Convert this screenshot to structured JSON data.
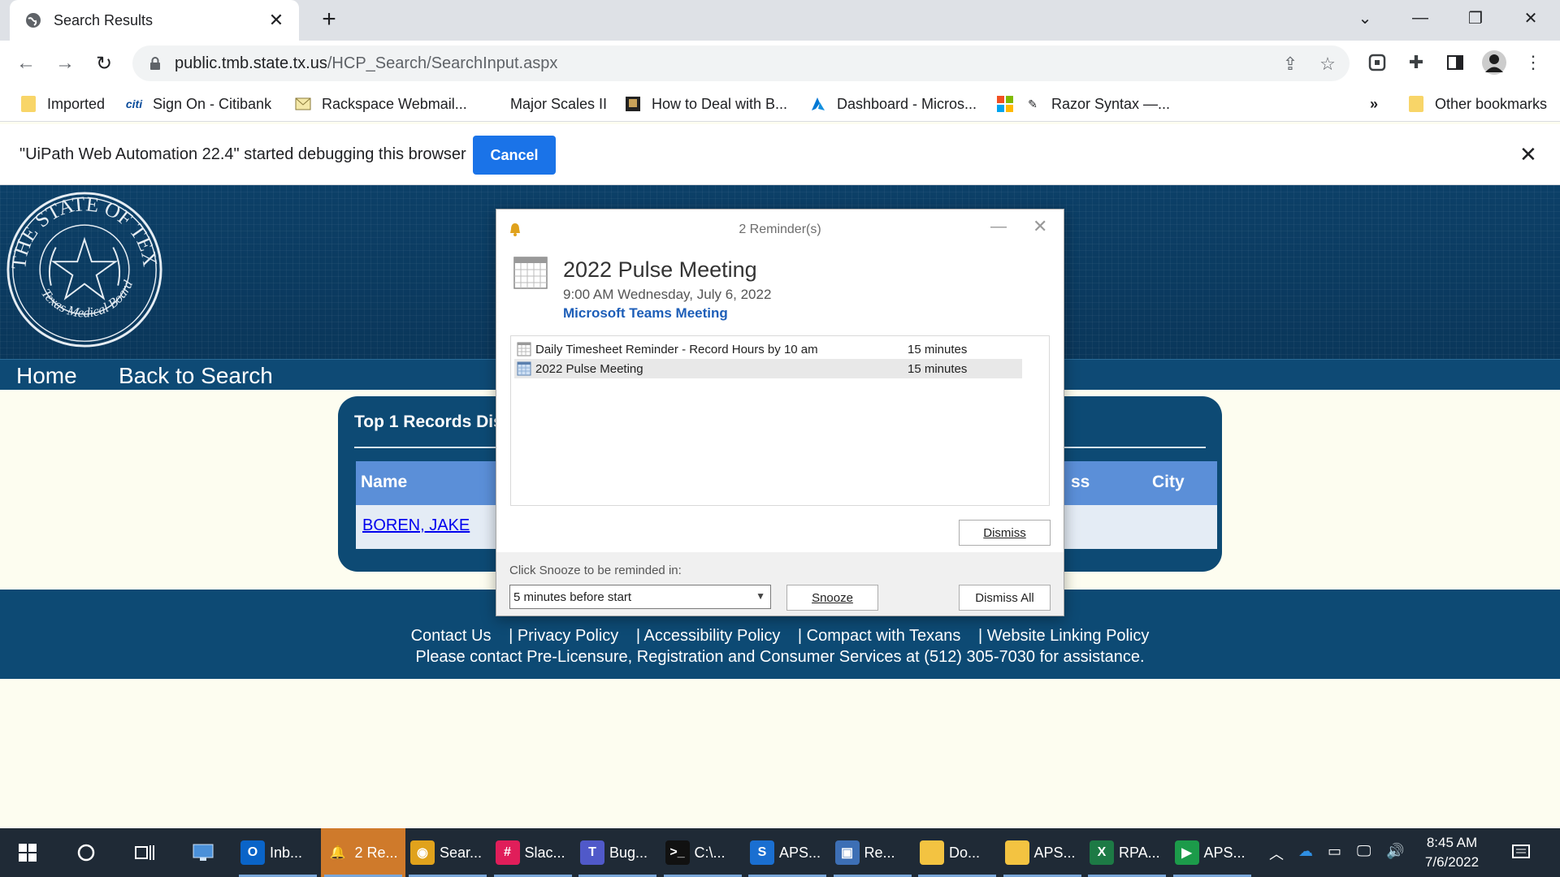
{
  "browser": {
    "tab": {
      "title": "Search Results"
    },
    "url_domain": "public.tmb.state.tx.us",
    "url_path": "/HCP_Search/SearchInput.aspx",
    "bookmarks": [
      {
        "label": "Imported"
      },
      {
        "label": "Sign On - Citibank",
        "icon_text": "citi"
      },
      {
        "label": "Rackspace Webmail..."
      },
      {
        "label": "Major Scales II"
      },
      {
        "label": "How to Deal with B..."
      },
      {
        "label": "Dashboard - Micros..."
      },
      {
        "label": "Razor Syntax —..."
      }
    ],
    "bookmarks_overflow": "»",
    "other_bookmarks": "Other bookmarks",
    "infobar": {
      "message": "\"UiPath Web Automation 22.4\" started debugging this browser",
      "cancel_label": "Cancel"
    }
  },
  "page": {
    "seal_text": "THE STATE OF TEXAS",
    "seal_subtext": "Texas Medical Board",
    "nav": {
      "home": "Home",
      "back": "Back to Search"
    },
    "results": {
      "title": "Top 1 Records Dis",
      "columns": [
        "Name",
        "ss",
        "City"
      ],
      "rows": [
        {
          "name": "BOREN, JAKE"
        }
      ]
    },
    "footer": {
      "links": [
        "Contact Us",
        "| Privacy Policy",
        "| Accessibility Policy",
        "| Compact with Texans",
        "| Website Linking Policy"
      ],
      "contact": "Please contact Pre-Licensure, Registration and Consumer Services at (512) 305-7030 for assistance."
    }
  },
  "reminder": {
    "window_title": "2 Reminder(s)",
    "subject": "2022 Pulse Meeting",
    "when": "9:00 AM Wednesday, July 6, 2022",
    "location": "Microsoft Teams Meeting",
    "items": [
      {
        "label": "Daily Timesheet Reminder - Record Hours by 10 am",
        "due": "15 minutes",
        "selected": false
      },
      {
        "label": "2022 Pulse Meeting",
        "due": "15 minutes",
        "selected": true
      }
    ],
    "dismiss_label": "Dismiss",
    "snooze_prompt": "Click Snooze to be reminded in:",
    "snooze_value": "5 minutes before start",
    "snooze_label": "Snooze",
    "dismiss_all_label": "Dismiss All"
  },
  "taskbar": {
    "apps": [
      {
        "label": "Inb...",
        "icon": "outlook-icon",
        "icon_text": "O",
        "color": "#0a64c8"
      },
      {
        "label": "2 Re...",
        "icon": "bell-icon",
        "icon_text": "🔔",
        "color": "#cf7a2b",
        "alert": true
      },
      {
        "label": "Sear...",
        "icon": "chrome-icon",
        "icon_text": "◉",
        "color": "#e0a21c"
      },
      {
        "label": "Slac...",
        "icon": "slack-icon",
        "icon_text": "#",
        "color": "#e01e5a"
      },
      {
        "label": "Bug...",
        "icon": "teams-icon",
        "icon_text": "T",
        "color": "#5059c9"
      },
      {
        "label": "C:\\...",
        "icon": "terminal-icon",
        "icon_text": ">_",
        "color": "#111111"
      },
      {
        "label": "APS...",
        "icon": "s-app-icon",
        "icon_text": "S",
        "color": "#1a6fd1"
      },
      {
        "label": "Re...",
        "icon": "remote-desktop-icon",
        "icon_text": "▣",
        "color": "#3d6fb5"
      },
      {
        "label": "Do...",
        "icon": "folder-icon",
        "icon_text": "",
        "color": "#f3c341"
      },
      {
        "label": "APS...",
        "icon": "folder-icon",
        "icon_text": "",
        "color": "#f3c341"
      },
      {
        "label": "RPA...",
        "icon": "excel-icon",
        "icon_text": "X",
        "color": "#1d7a45"
      },
      {
        "label": "APS...",
        "icon": "player-icon",
        "icon_text": "▶",
        "color": "#1c9b4a"
      }
    ],
    "time": "8:45 AM",
    "date": "7/6/2022"
  }
}
